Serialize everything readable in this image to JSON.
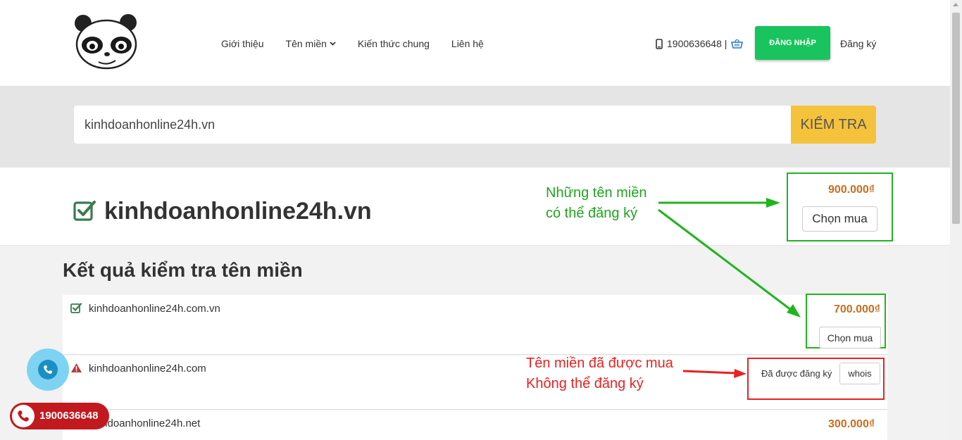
{
  "nav": {
    "items": [
      {
        "label": "Giới thiệu"
      },
      {
        "label": "Tên miền"
      },
      {
        "label": "Kiến thức chung"
      },
      {
        "label": "Liên hệ"
      }
    ],
    "phone": "1900636648 |",
    "login_label": "ĐĂNG NHẬP",
    "register_label": "Đăng ký"
  },
  "search": {
    "value": "kinhdoanhonline24h.vn",
    "button_label": "KIỂM TRA"
  },
  "main_result": {
    "domain": "kinhdoanhonline24h.vn",
    "price": "900.000₫",
    "buy_label": "Chọn mua"
  },
  "results": {
    "heading": "Kết quả kiểm tra tên miền",
    "rows": [
      {
        "domain": "kinhdoanhonline24h.com.vn",
        "price": "700.000₫",
        "buy_label": "Chọn mua"
      },
      {
        "domain": "kinhdoanhonline24h.com",
        "status": "Đã được đăng ký",
        "whois_label": "whois"
      },
      {
        "domain": "kinhdoanhonline24h.net",
        "price": "300.000₫"
      }
    ]
  },
  "annotations": {
    "green_line1": "Những tên miền",
    "green_line2": "có thể đăng ký",
    "red_line1": "Tên miền đã được mua",
    "red_line2": "Không thể đăng ký"
  },
  "floating": {
    "hotline": "1900636648"
  },
  "colors": {
    "login_bg": "#19c45e",
    "search_btn": "#f5c33b",
    "price": "#c86e1d",
    "annotation_green": "#1fb51f",
    "annotation_red": "#e82222",
    "hotline_bg": "#c2191f"
  }
}
